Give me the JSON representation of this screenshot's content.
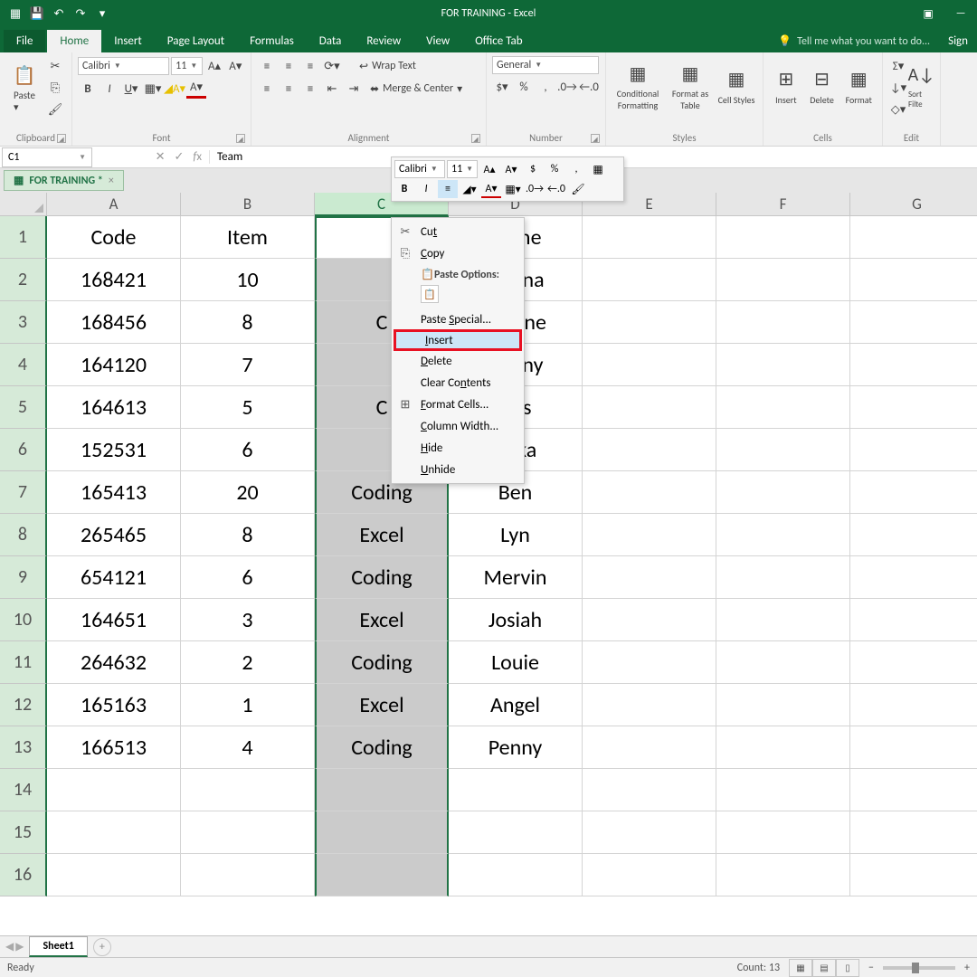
{
  "app": {
    "title": "FOR TRAINING - Excel"
  },
  "qat": {
    "save": "💾",
    "undo": "↶",
    "redo": "↷"
  },
  "menu": {
    "file": "File",
    "tabs": [
      "Home",
      "Insert",
      "Page Layout",
      "Formulas",
      "Data",
      "Review",
      "View",
      "Office Tab"
    ],
    "tell": "Tell me what you want to do...",
    "sign": "Sign"
  },
  "ribbon": {
    "clipboard": {
      "paste": "Paste",
      "label": "Clipboard"
    },
    "font": {
      "name": "Calibri",
      "size": "11",
      "label": "Font"
    },
    "align": {
      "wrap": "Wrap Text",
      "merge": "Merge & Center",
      "label": "Alignment"
    },
    "number": {
      "fmt": "General",
      "label": "Number"
    },
    "styles": {
      "cond": "Conditional Formatting",
      "table": "Format as Table",
      "cell": "Cell Styles",
      "label": "Styles"
    },
    "cells": {
      "insert": "Insert",
      "delete": "Delete",
      "format": "Format",
      "label": "Cells"
    },
    "editing": {
      "sort": "Sort Filte",
      "label": "Edit"
    }
  },
  "namebox": "C1",
  "formula": "Team",
  "wbtab": "FOR TRAINING *",
  "mini": {
    "font": "Calibri",
    "size": "11"
  },
  "ctx": {
    "cut": "Cut",
    "copy": "Copy",
    "popt": "Paste Options:",
    "pspecial": "Paste Special...",
    "insert": "Insert",
    "delete": "Delete",
    "clear": "Clear Contents",
    "fmt": "Format Cells...",
    "colw": "Column Width...",
    "hide": "Hide",
    "unhide": "Unhide"
  },
  "cols": [
    "A",
    "B",
    "C",
    "D",
    "E",
    "F",
    "G"
  ],
  "headers": {
    "A": "Code",
    "B": "Item",
    "C": "",
    "D": "Name"
  },
  "rows": [
    {
      "A": "168421",
      "B": "10",
      "C": "",
      "D": "Donna"
    },
    {
      "A": "168456",
      "B": "8",
      "C": "C",
      "D": "ernane"
    },
    {
      "A": "164120",
      "B": "7",
      "C": "",
      "D": "Danny"
    },
    {
      "A": "164613",
      "B": "5",
      "C": "C",
      "D": "Cris"
    },
    {
      "A": "152531",
      "B": "6",
      "C": "",
      "D": "Erika"
    },
    {
      "A": "165413",
      "B": "20",
      "C": "Coding",
      "D": "Ben"
    },
    {
      "A": "265465",
      "B": "8",
      "C": "Excel",
      "D": "Lyn"
    },
    {
      "A": "654121",
      "B": "6",
      "C": "Coding",
      "D": "Mervin"
    },
    {
      "A": "164651",
      "B": "3",
      "C": "Excel",
      "D": "Josiah"
    },
    {
      "A": "264632",
      "B": "2",
      "C": "Coding",
      "D": "Louie"
    },
    {
      "A": "165163",
      "B": "1",
      "C": "Excel",
      "D": "Angel"
    },
    {
      "A": "166513",
      "B": "4",
      "C": "Coding",
      "D": "Penny"
    },
    {
      "A": "",
      "B": "",
      "C": "",
      "D": ""
    },
    {
      "A": "",
      "B": "",
      "C": "",
      "D": ""
    },
    {
      "A": "",
      "B": "",
      "C": "",
      "D": ""
    }
  ],
  "sheet": {
    "name": "Sheet1"
  },
  "status": {
    "ready": "Ready",
    "count": "Count: 13"
  }
}
